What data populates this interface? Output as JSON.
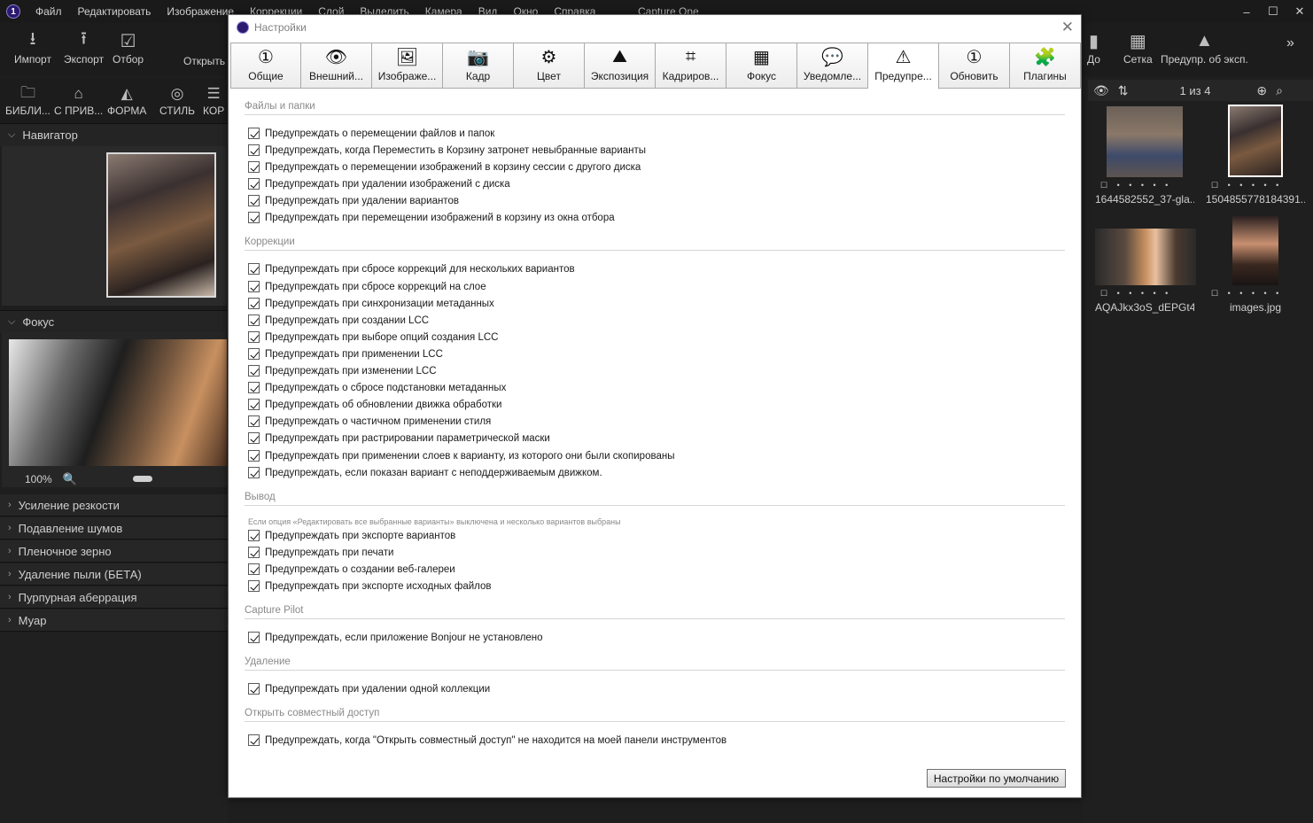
{
  "app": {
    "title": "Capture One",
    "menu": [
      "Файл",
      "Редактировать",
      "Изображение",
      "Коррекции",
      "Слой",
      "Выделить",
      "Камера",
      "Вид",
      "Окно",
      "Справка"
    ],
    "window_controls": [
      "–",
      "☐",
      "✕"
    ]
  },
  "toolbar": {
    "import_label": "Импорт",
    "export_label": "Экспорт",
    "select_label": "Отбор",
    "open_label": "Открыть",
    "before_label": "До",
    "grid_label": "Сетка",
    "warn_label": "Предупр. об эксп.",
    "more_icon": "»"
  },
  "tool_tabs": [
    "БИБЛИ...",
    "С ПРИВ...",
    "ФОРМА",
    "СТИЛЬ",
    "КОР"
  ],
  "left_panels": {
    "navigator": "Навигатор",
    "focus": "Фокус",
    "zoom": "100%",
    "tools": [
      "Усиление резкости",
      "Подавление шумов",
      "Пленочное зерно",
      "Удаление пыли (БЕТА)",
      "Пурпурная аберрация",
      "Муар"
    ]
  },
  "browser": {
    "count": "1 из 4",
    "thumbnails": [
      {
        "name": "1644582552_37-gla..."
      },
      {
        "name": "1504855778184391..."
      },
      {
        "name": "AQAJkx3oS_dEPGt4..."
      },
      {
        "name": "images.jpg"
      }
    ]
  },
  "dialog": {
    "title": "Настройки",
    "tabs": [
      {
        "label": "Общие",
        "icon": "①"
      },
      {
        "label": "Внешний...",
        "icon": "👁"
      },
      {
        "label": "Изображе...",
        "icon": "🖼"
      },
      {
        "label": "Кадр",
        "icon": "📷"
      },
      {
        "label": "Цвет",
        "icon": "⚙"
      },
      {
        "label": "Экспозиция",
        "icon": "⛰"
      },
      {
        "label": "Кадриров...",
        "icon": "⌗"
      },
      {
        "label": "Фокус",
        "icon": "▦"
      },
      {
        "label": "Уведомле...",
        "icon": "💬"
      },
      {
        "label": "Предупре...",
        "icon": "⚠"
      },
      {
        "label": "Обновить",
        "icon": "①"
      },
      {
        "label": "Плагины",
        "icon": "🧩"
      }
    ],
    "active_tab": "Предупре...",
    "sections": {
      "files_title": "Файлы и папки",
      "files": [
        "Предупреждать о перемещении файлов и папок",
        "Предупреждать, когда Переместить в Корзину затронет невыбранные варианты",
        "Предупреждать о перемещении изображений в корзину сессии с другого диска",
        "Предупреждать при удалении изображений с диска",
        "Предупреждать при удалении вариантов",
        "Предупреждать при перемещении изображений в корзину из окна отбора"
      ],
      "corrections_title": "Коррекции",
      "corrections": [
        "Предупреждать при сбросе коррекций для нескольких вариантов",
        "Предупреждать при сбросе коррекций на слое",
        "Предупреждать при синхронизации метаданных",
        "Предупреждать при создании LCC",
        "Предупреждать при выборе опций создания LCC",
        "Предупреждать при применении LCC",
        "Предупреждать при изменении LCC",
        "Предупреждать о сбросе подстановки метаданных",
        "Предупреждать об обновлении движка обработки",
        "Предупреждать о частичном применении стиля",
        "Предупреждать при растрировании параметрической маски",
        "Предупреждать при применении слоев к варианту, из которого они были скопированы",
        "Предупреждать, если показан вариант с неподдерживаемым движком."
      ],
      "output_title": "Вывод",
      "output_note": "Если опция «Редактировать все выбранные варианты» выключена и несколько вариантов выбраны",
      "output": [
        "Предупреждать при экспорте вариантов",
        "Предупреждать при печати",
        "Предупреждать о создании веб-галереи",
        "Предупреждать при экспорте исходных файлов"
      ],
      "pilot_title": "Capture Pilot",
      "pilot": [
        "Предупреждать, если приложение Bonjour не установлено"
      ],
      "delete_title": "Удаление",
      "delete": [
        "Предупреждать при удалении одной коллекции"
      ],
      "share_title": "Открыть совместный доступ",
      "share": [
        "Предупреждать, когда \"Открыть совместный доступ\" не находится на моей панели инструментов"
      ]
    },
    "defaults_button": "Настройки по умолчанию"
  }
}
